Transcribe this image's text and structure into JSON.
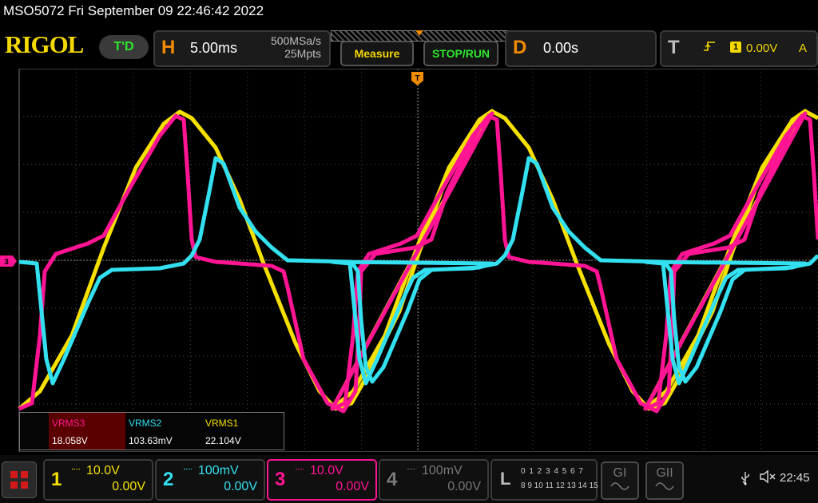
{
  "header": {
    "title": "MSO5072  Fri September 09 22:46:42 2022",
    "brand": "RIGOL",
    "td_status": "T'D"
  },
  "horizontal": {
    "letter": "H",
    "timebase": "5.00ms",
    "sample_rate": "500MSa/s",
    "memory_depth": "25Mpts"
  },
  "buttons": {
    "measure": "Measure",
    "stop_run": "STOP/RUN"
  },
  "delay": {
    "letter": "D",
    "value": "0.00s"
  },
  "trigger": {
    "letter": "T",
    "edge_icon": "rising-edge-icon",
    "source": "1",
    "level": "0.00V",
    "mode": "A"
  },
  "screen": {
    "trigger_marker": "T",
    "ch3_marker": "3"
  },
  "measurements": [
    {
      "label": "VRMS3",
      "value": "18.058V",
      "color": "#ff1493"
    },
    {
      "label": "VRMS2",
      "value": "103.63mV",
      "color": "#33e0f0"
    },
    {
      "label": "VRMS1",
      "value": "22.104V",
      "color": "#f5e000"
    }
  ],
  "channels": [
    {
      "num": "1",
      "scale": "10.0V",
      "offset": "0.00V",
      "color": "#f5e000",
      "active": false
    },
    {
      "num": "2",
      "scale": "100mV",
      "offset": "0.00V",
      "color": "#33e0f0",
      "active": false
    },
    {
      "num": "3",
      "scale": "10.0V",
      "offset": "0.00V",
      "color": "#ff1493",
      "active": true
    },
    {
      "num": "4",
      "scale": "100mV",
      "offset": "0.00V",
      "color": "#777777",
      "active": false
    }
  ],
  "logic": {
    "letter": "L",
    "row1": "0 1 2 3  4 5 6 7",
    "row2": "8 9 10 11 12 13 14 15"
  },
  "generators": [
    "GI",
    "GII"
  ],
  "status": {
    "time": "22:45"
  },
  "colors": {
    "ch1": "#f5e000",
    "ch2": "#33e0f0",
    "ch3": "#ff1493",
    "accent": "#f08a00"
  }
}
